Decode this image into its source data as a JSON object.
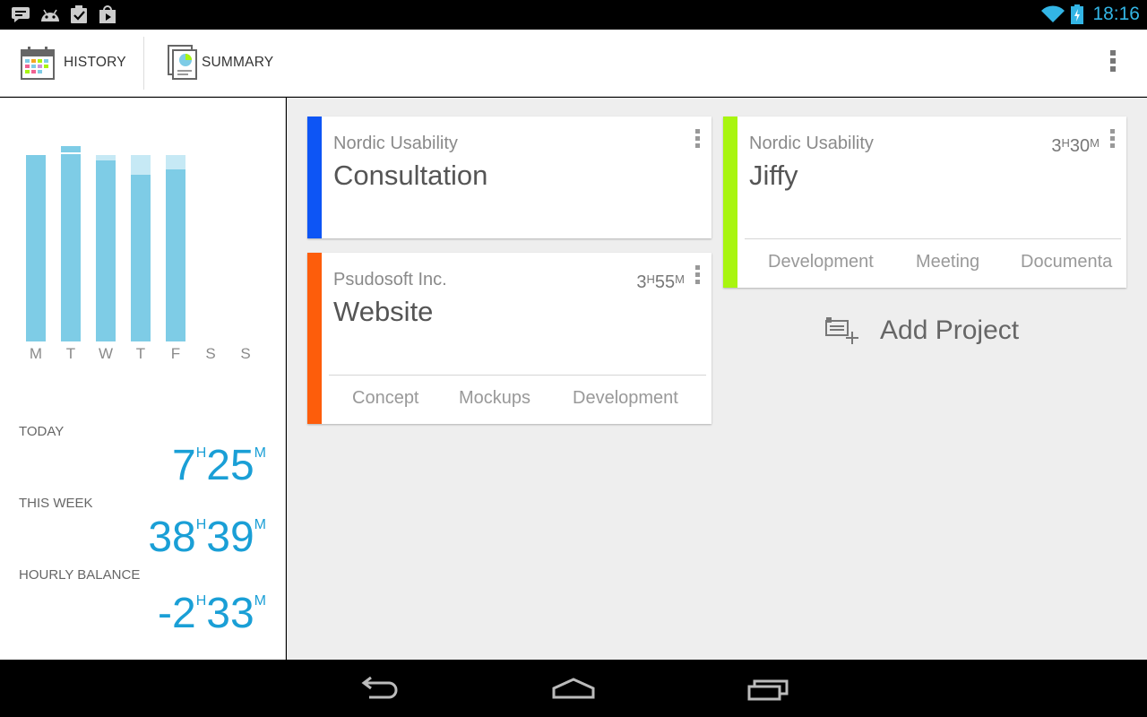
{
  "status_bar": {
    "time": "18:16",
    "left_icons": [
      "talk-icon",
      "android-icon",
      "clipboard-check-icon",
      "play-store-icon"
    ],
    "right_icons": [
      "wifi-icon",
      "battery-charging-icon"
    ],
    "accent": "#33b5e5"
  },
  "action_bar": {
    "tabs": [
      {
        "label": "HISTORY",
        "icon": "calendar-icon"
      },
      {
        "label": "SUMMARY",
        "icon": "report-icon"
      }
    ],
    "overflow_icon": "overflow-menu-icon"
  },
  "week_chart": {
    "days": [
      "M",
      "T",
      "W",
      "T",
      "F",
      "S",
      "S"
    ],
    "bar_color": "#7ecce6",
    "overtime_color": "#c6e9f5"
  },
  "stats": {
    "today": {
      "label": "TODAY",
      "hours": "7",
      "hours_unit": "H",
      "minutes": "25",
      "minutes_unit": "M"
    },
    "week": {
      "label": "THIS WEEK",
      "hours": "38",
      "hours_unit": "H",
      "minutes": "39",
      "minutes_unit": "M"
    },
    "balance": {
      "label": "HOURLY BALANCE",
      "hours": "-2",
      "hours_unit": "H",
      "minutes": "33",
      "minutes_unit": "M"
    },
    "color": "#1a9fd6"
  },
  "projects": [
    {
      "client": "Nordic Usability",
      "name": "Consultation",
      "color": "#0d55f5",
      "duration": null,
      "tasks": []
    },
    {
      "client": "Psudosoft Inc.",
      "name": "Website",
      "color": "#fd5d0b",
      "duration": {
        "hours": "3",
        "hours_unit": "H",
        "minutes": "55",
        "minutes_unit": "M"
      },
      "tasks": [
        "Concept",
        "Mockups",
        "Development"
      ]
    },
    {
      "client": "Nordic Usability",
      "name": "Jiffy",
      "color": "#a8f510",
      "duration": {
        "hours": "3",
        "hours_unit": "H",
        "minutes": "30",
        "minutes_unit": "M"
      },
      "tasks": [
        "Development",
        "Meeting",
        "Documenta"
      ]
    }
  ],
  "add_project": {
    "label": "Add Project",
    "icon": "add-project-icon"
  },
  "nav_bar": {
    "buttons": [
      "back-icon",
      "home-icon",
      "recent-apps-icon"
    ]
  }
}
